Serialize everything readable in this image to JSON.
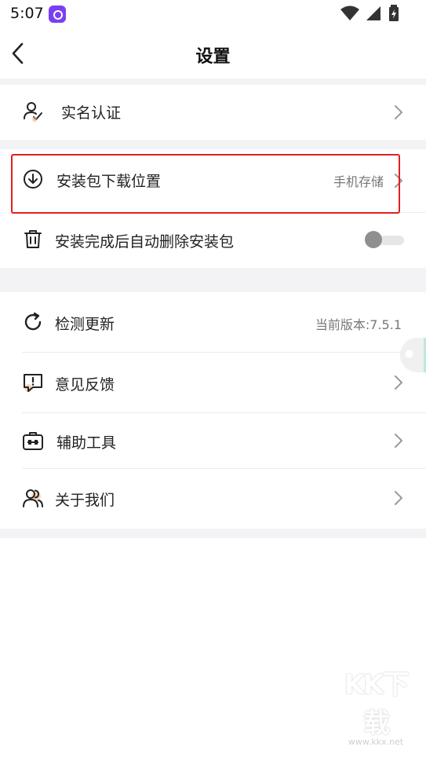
{
  "status_bar": {
    "time": "5:07"
  },
  "header": {
    "title": "设置"
  },
  "sections": {
    "verification": {
      "label": "实名认证"
    },
    "download_location": {
      "label": "安装包下载位置",
      "value": "手机存储"
    },
    "auto_delete": {
      "label": "安装完成后自动删除安装包",
      "enabled": false
    },
    "check_update": {
      "label": "检测更新",
      "value": "当前版本:7.5.1"
    },
    "feedback": {
      "label": "意见反馈"
    },
    "tools": {
      "label": "辅助工具"
    },
    "about": {
      "label": "关于我们"
    }
  },
  "watermark": {
    "logo": "KK下载",
    "url": "www.kkx.net"
  },
  "colors": {
    "accent_orange": "#f6b27a",
    "highlight_red": "#e02020",
    "section_gap": "#f3f3f5"
  }
}
